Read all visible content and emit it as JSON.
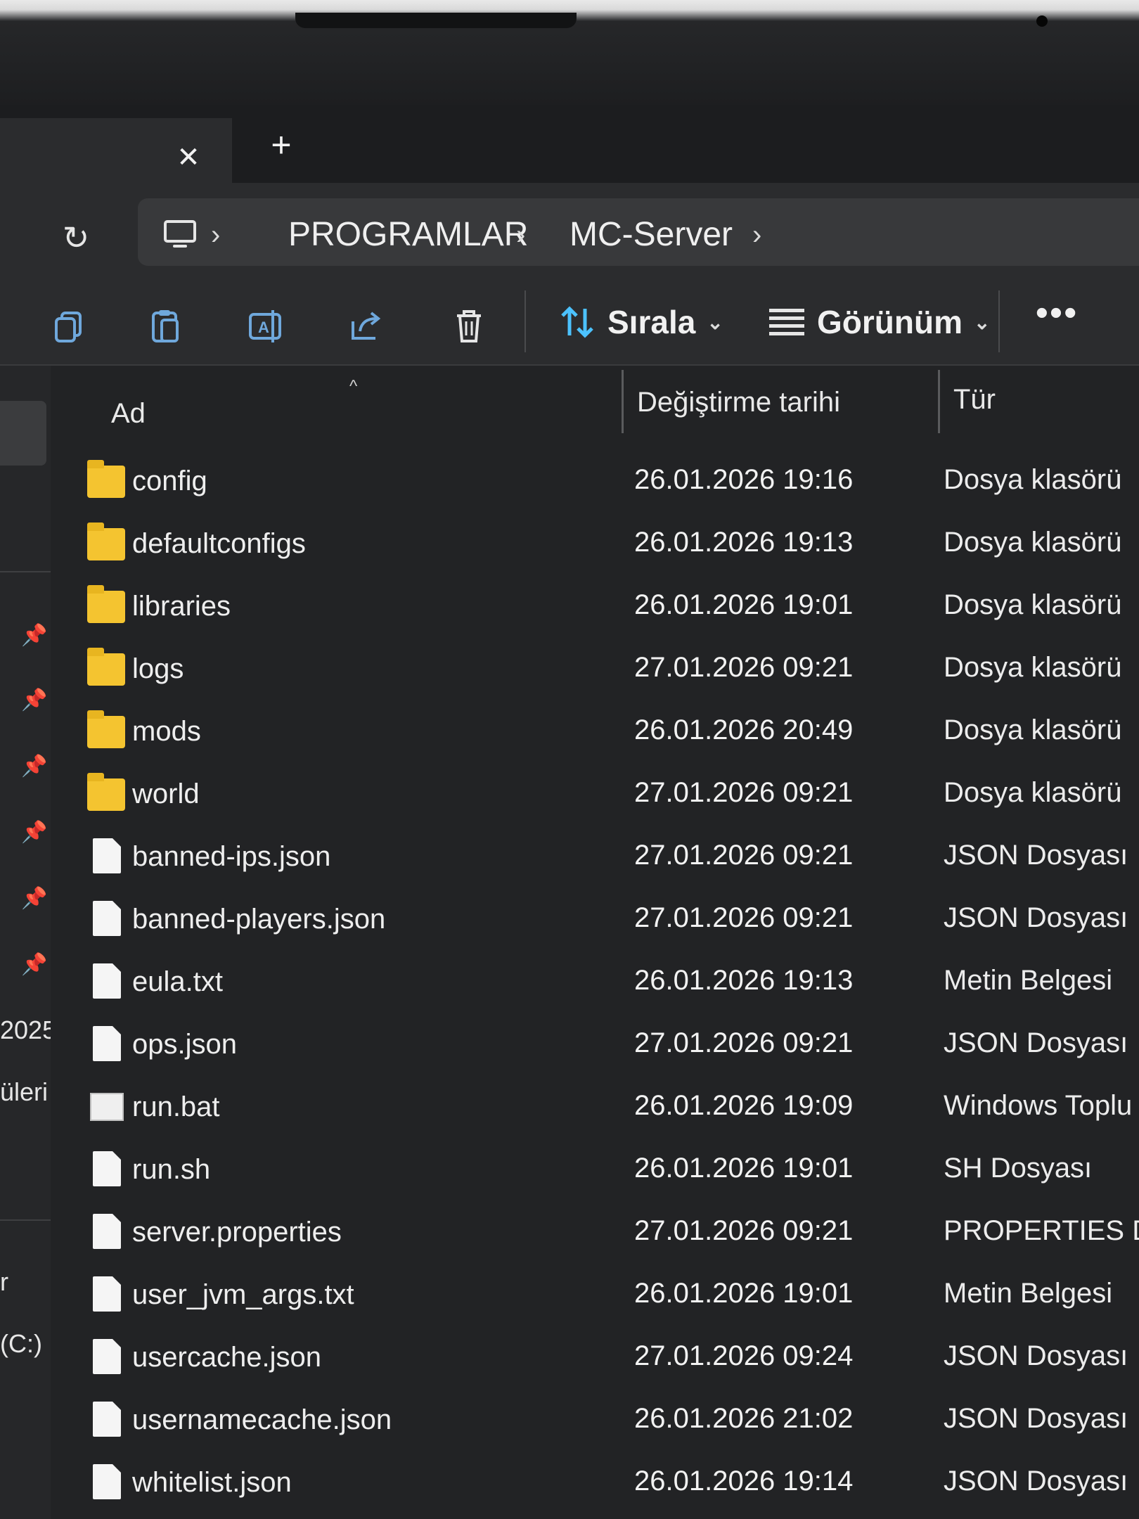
{
  "window": {
    "tab_close_glyph": "✕",
    "new_tab_glyph": "+"
  },
  "address_bar": {
    "refresh_glyph": "↻",
    "breadcrumbs": [
      "PROGRAMLAR",
      "MC-Server"
    ],
    "separator_glyph": "›"
  },
  "toolbar": {
    "sort_label": "Sırala",
    "view_label": "Görünüm",
    "more_glyph": "•••",
    "caret_glyph": "⌄"
  },
  "nav_pane": {
    "partial_texts": [
      "2025",
      "üleri",
      "r",
      "(C:)"
    ],
    "pin_glyph": "📌"
  },
  "columns": {
    "name": "Ad",
    "modified": "Değiştirme tarihi",
    "type": "Tür"
  },
  "files": [
    {
      "name": "config",
      "date": "26.01.2026 19:16",
      "type": "Dosya klasörü",
      "icon": "folder-icon"
    },
    {
      "name": "defaultconfigs",
      "date": "26.01.2026 19:13",
      "type": "Dosya klasörü",
      "icon": "folder-icon"
    },
    {
      "name": "libraries",
      "date": "26.01.2026 19:01",
      "type": "Dosya klasörü",
      "icon": "folder-icon"
    },
    {
      "name": "logs",
      "date": "27.01.2026 09:21",
      "type": "Dosya klasörü",
      "icon": "folder-icon"
    },
    {
      "name": "mods",
      "date": "26.01.2026 20:49",
      "type": "Dosya klasörü",
      "icon": "folder-icon"
    },
    {
      "name": "world",
      "date": "27.01.2026 09:21",
      "type": "Dosya klasörü",
      "icon": "folder-icon"
    },
    {
      "name": "banned-ips.json",
      "date": "27.01.2026 09:21",
      "type": "JSON Dosyası",
      "icon": "file-icon"
    },
    {
      "name": "banned-players.json",
      "date": "27.01.2026 09:21",
      "type": "JSON Dosyası",
      "icon": "file-icon"
    },
    {
      "name": "eula.txt",
      "date": "26.01.2026 19:13",
      "type": "Metin Belgesi",
      "icon": "file-icon"
    },
    {
      "name": "ops.json",
      "date": "27.01.2026 09:21",
      "type": "JSON Dosyası",
      "icon": "file-icon"
    },
    {
      "name": "run.bat",
      "date": "26.01.2026 19:09",
      "type": "Windows Toplu İş",
      "icon": "bat-icon"
    },
    {
      "name": "run.sh",
      "date": "26.01.2026 19:01",
      "type": "SH Dosyası",
      "icon": "file-icon"
    },
    {
      "name": "server.properties",
      "date": "27.01.2026 09:21",
      "type": "PROPERTIES Dosy",
      "icon": "file-icon"
    },
    {
      "name": "user_jvm_args.txt",
      "date": "26.01.2026 19:01",
      "type": "Metin Belgesi",
      "icon": "file-icon"
    },
    {
      "name": "usercache.json",
      "date": "27.01.2026 09:24",
      "type": "JSON Dosyası",
      "icon": "file-icon"
    },
    {
      "name": "usernamecache.json",
      "date": "26.01.2026 21:02",
      "type": "JSON Dosyası",
      "icon": "file-icon"
    },
    {
      "name": "whitelist.json",
      "date": "26.01.2026 19:14",
      "type": "JSON Dosyası",
      "icon": "file-icon"
    }
  ],
  "colors": {
    "folder": "#f4c430",
    "accent": "#4cc2ff",
    "background": "#222325"
  }
}
